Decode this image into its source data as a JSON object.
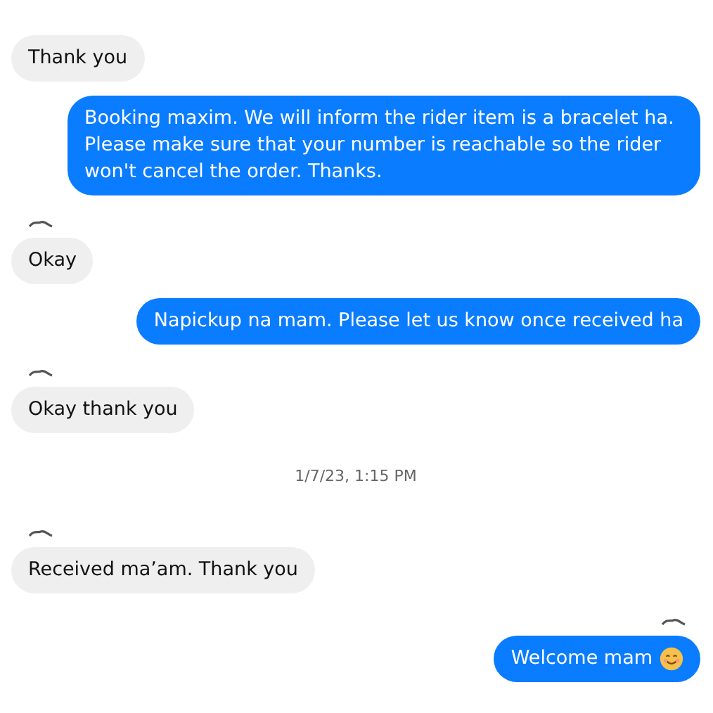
{
  "messages": [
    {
      "kind": "incoming",
      "text": "Thank you",
      "show_sender": false,
      "emoji": false
    },
    {
      "kind": "outgoing",
      "text": "Booking maxim. We will inform the rider item is a bracelet ha. Please make sure that your number is reachable so the rider won't cancel the order. Thanks.",
      "show_sender": false,
      "emoji": false
    },
    {
      "kind": "incoming",
      "text": "Okay",
      "show_sender": true,
      "emoji": false
    },
    {
      "kind": "outgoing",
      "text": "Napickup na mam. Please let us know once received ha",
      "show_sender": false,
      "emoji": false
    },
    {
      "kind": "incoming",
      "text": "Okay thank you",
      "show_sender": true,
      "emoji": false
    },
    {
      "kind": "timestamp",
      "text": "1/7/23, 1:15 PM"
    },
    {
      "kind": "incoming",
      "text": "Received ma’am. Thank you",
      "show_sender": true,
      "emoji": false
    },
    {
      "kind": "outgoing",
      "text": "Welcome mam",
      "show_sender": true,
      "emoji": true
    }
  ]
}
